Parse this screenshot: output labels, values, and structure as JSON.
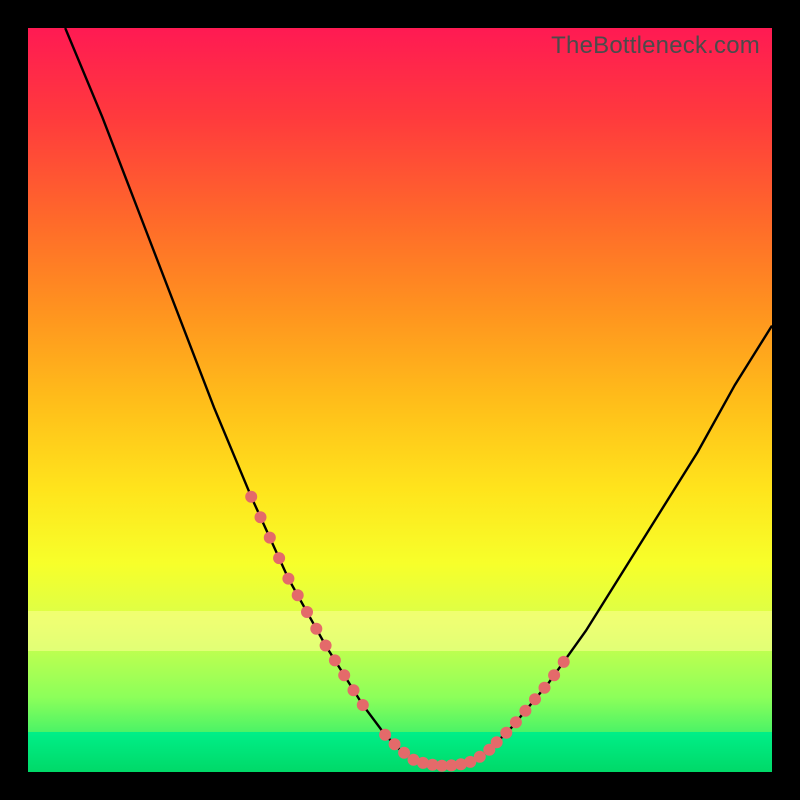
{
  "watermark": "TheBottleneck.com",
  "chart_data": {
    "type": "line",
    "title": "",
    "xlabel": "",
    "ylabel": "",
    "xlim": [
      0,
      100
    ],
    "ylim": [
      0,
      100
    ],
    "series": [
      {
        "name": "bottleneck-curve",
        "x": [
          5,
          10,
          15,
          20,
          25,
          30,
          35,
          40,
          45,
          48,
          50,
          52,
          54,
          56,
          58,
          60,
          62,
          65,
          70,
          75,
          80,
          85,
          90,
          95,
          100
        ],
        "values": [
          100,
          88,
          75,
          62,
          49,
          37,
          26,
          17,
          9,
          5,
          3,
          1.5,
          1,
          0.8,
          1,
          1.5,
          3,
          6,
          12,
          19,
          27,
          35,
          43,
          52,
          60
        ]
      }
    ],
    "highlighted_segments": [
      {
        "name": "left-descent-dots",
        "x_range": [
          30,
          45
        ]
      },
      {
        "name": "valley-dots",
        "x_range": [
          48,
          62
        ]
      },
      {
        "name": "right-ascent-dots",
        "x_range": [
          63,
          72
        ]
      }
    ],
    "colors": {
      "curve": "#000000",
      "dots": "#e46a6a",
      "gradient_top": "#ff1a53",
      "gradient_bottom": "#00e574"
    }
  }
}
